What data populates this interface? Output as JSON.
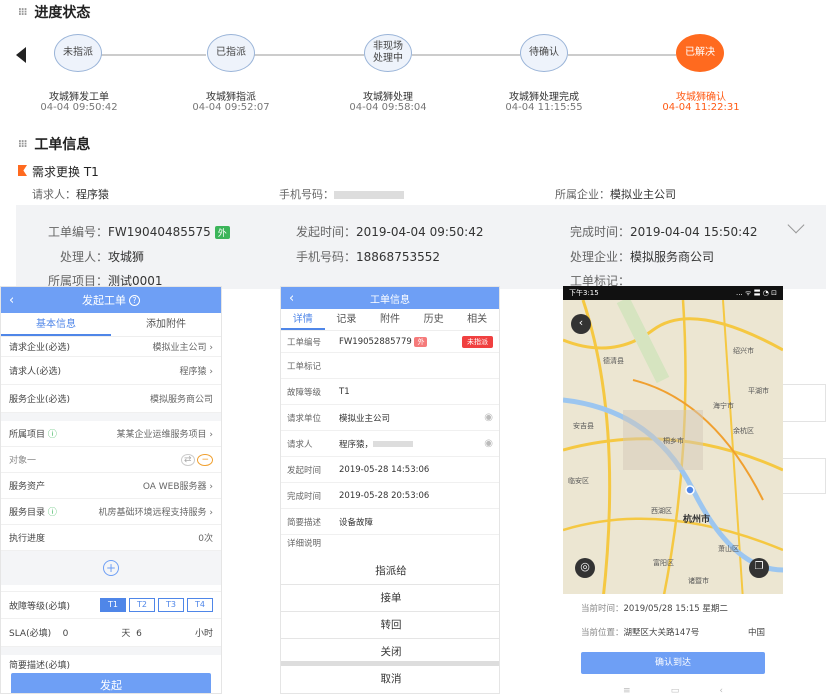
{
  "progress": {
    "title": "进度状态",
    "nodes": [
      {
        "label": "未指派",
        "name": "攻城狮发工单",
        "time": "04-04 09:50:42"
      },
      {
        "label": "已指派",
        "name": "攻城狮指派",
        "time": "04-04 09:52:07"
      },
      {
        "label": "非现场处理中",
        "name": "攻城狮处理",
        "time": "04-04 09:58:04"
      },
      {
        "label": "待确认",
        "name": "攻城狮处理完成",
        "time": "04-04 11:15:55"
      },
      {
        "label": "已解决",
        "name": "攻城狮确认",
        "time": "04-04 11:22:31"
      }
    ]
  },
  "order": {
    "title": "工单信息",
    "subject": "需求更换 T1",
    "requester_label": "请求人：",
    "requester": "程序猿",
    "phone_label": "手机号码：",
    "company_label": "所属企业：",
    "company": "模拟业主公司",
    "no_label": "工单编号：",
    "no": "FW19040485575",
    "no_badge": "外",
    "start_label": "发起时间：",
    "start": "2019-04-04 09:50:42",
    "finish_label": "完成时间：",
    "finish": "2019-04-04 15:50:42",
    "handler_label": "处理人：",
    "handler": "攻城狮",
    "hphone_label": "手机号码：",
    "hphone": "18868753552",
    "hcompany_label": "处理企业：",
    "hcompany": "模拟服务商公司",
    "project_label": "所属项目：",
    "project": "测试0001",
    "mark_label": "工单标记："
  },
  "phone1": {
    "title": "发起工单",
    "tabs": [
      "基本信息",
      "添加附件"
    ],
    "rows": [
      {
        "k": "请求企业(必选)",
        "v": "模拟业主公司"
      },
      {
        "k": "请求人(必选)",
        "v": "程序猿"
      },
      {
        "k": "服务企业(必选)",
        "v": "模拟服务商公司"
      },
      {
        "k": "所属项目",
        "v": "某某企业运维服务项目"
      },
      {
        "k": "对象一",
        "v": ""
      },
      {
        "k": "服务资产",
        "v": "OA WEB服务器"
      },
      {
        "k": "服务目录",
        "v": "机房基础环境远程支持服务"
      },
      {
        "k": "执行进度",
        "v": "0次"
      }
    ],
    "level_label": "故障等级(必填)",
    "levels": [
      "T1",
      "T2",
      "T3",
      "T4"
    ],
    "sla_label": "SLA(必填)",
    "sla_day": "0",
    "sla_day_unit": "天",
    "sla_hour": "6",
    "sla_hour_unit": "小时",
    "desc_label": "简要描述(必填)",
    "submit": "发起"
  },
  "phone2": {
    "title": "工单信息",
    "tabs": [
      "详情",
      "记录",
      "附件",
      "历史",
      "相关"
    ],
    "rows": [
      {
        "k": "工单编号",
        "v": "FW19052885779"
      },
      {
        "k": "工单标记",
        "v": ""
      },
      {
        "k": "故障等级",
        "v": "T1"
      },
      {
        "k": "请求单位",
        "v": "模拟业主公司"
      },
      {
        "k": "请求人",
        "v": "程序猿，"
      },
      {
        "k": "发起时间",
        "v": "2019-05-28 14:53:06"
      },
      {
        "k": "完成时间",
        "v": "2019-05-28 20:53:06"
      },
      {
        "k": "简要描述",
        "v": "设备故障"
      },
      {
        "k": "详细说明",
        "v": ""
      }
    ],
    "no_badge": "外",
    "status": "未指派",
    "actions": [
      "指派给",
      "接单",
      "转回",
      "关闭",
      "取消"
    ]
  },
  "phone3": {
    "status_time": "下午3:15",
    "status_icons": "... ᯤ 〓 ◔ ⊡",
    "places": [
      "杭州市",
      "西湖区",
      "余杭区",
      "萧山区",
      "富阳区",
      "诸暨市",
      "德清县",
      "安吉县",
      "绍兴市",
      "平湖市",
      "海宁市",
      "桐乡市",
      "临安区"
    ],
    "time_label": "当前时间：",
    "time": "2019/05/28 15:15 星期二",
    "loc_label": "当前位置：",
    "loc": "湖墅区大关路147号",
    "loc_suffix": "中国",
    "confirm": "确认到达"
  }
}
